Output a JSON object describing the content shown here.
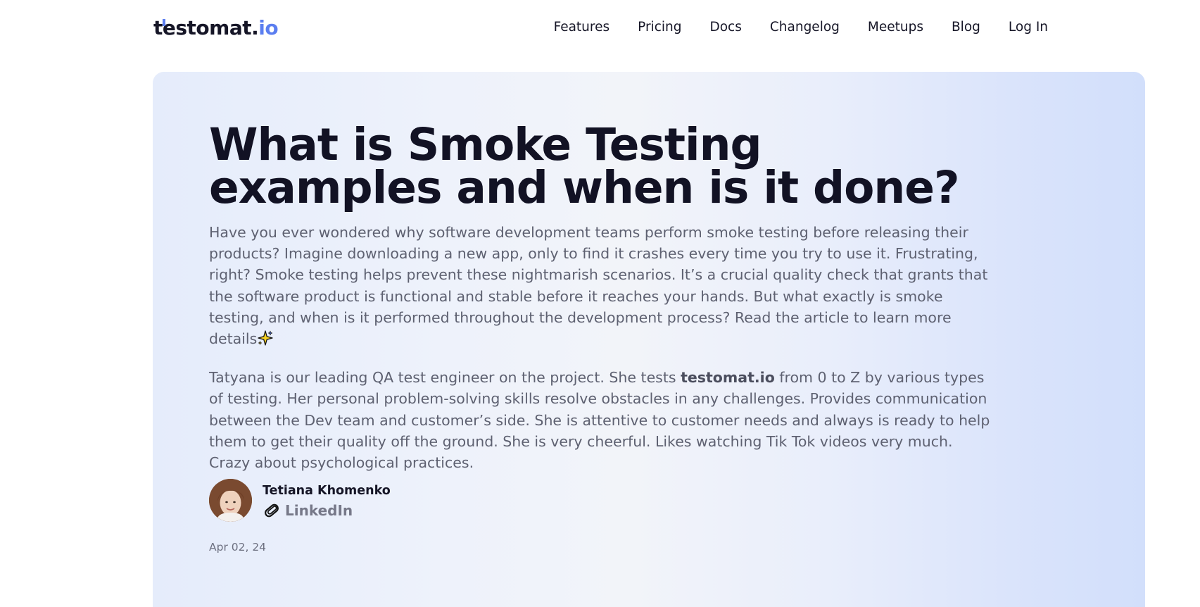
{
  "header": {
    "logo_main": "testomat.",
    "logo_tld": "io",
    "nav": [
      {
        "label": "Features"
      },
      {
        "label": "Pricing"
      },
      {
        "label": "Docs"
      },
      {
        "label": "Changelog"
      },
      {
        "label": "Meetups"
      },
      {
        "label": "Blog"
      },
      {
        "label": "Log In"
      }
    ]
  },
  "article": {
    "title": "What is Smoke Testing examples and when is it done?",
    "intro": "Have you ever wondered why software development teams perform smoke testing before releasing their products? Imagine downloading a new app, only to find it crashes every time you try to use it. Frustrating, right? Smoke testing helps prevent these nightmarish scenarios. It’s a crucial quality check that grants that the software product is functional and stable before it reaches your hands. But what exactly is smoke testing, and when is it performed throughout the development process? Read the article to learn more details",
    "intro_icon": "sparkle-icon",
    "bio_before": "Tatyana is our leading QA test engineer on the project. She tests ",
    "bio_bold": "testomat.io",
    "bio_after": " from 0 to Z by various types of testing. Her personal problem-solving skills resolve obstacles in any challenges. Provides communication between the Dev team and customer’s side. She is attentive to customer needs and always is ready to help them to get their quality off the ground. She is very cheerful. Likes watching Tik Tok videos very much. Crazy about psychological practices.",
    "author": {
      "name": "Tetiana Khomenko",
      "link_label": "LinkedIn",
      "link_icon": "paperclip-icon"
    },
    "date": "Apr 02, 24"
  },
  "colors": {
    "accent": "#5b7ef0",
    "title": "#121224",
    "body_text": "#5e6171"
  }
}
